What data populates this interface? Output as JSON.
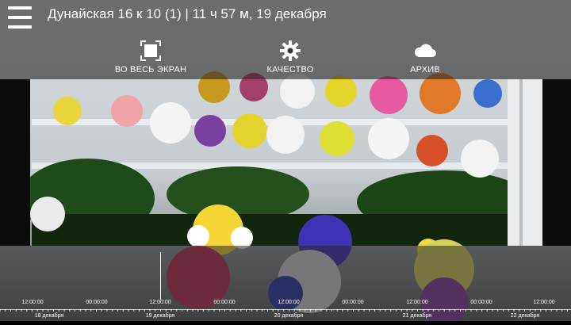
{
  "header": {
    "title": "Дунайская 16 к 10 (1) | 11 ч 57 м, 19 декабря"
  },
  "toolbar": {
    "fullscreen_label": "ВО ВЕСЬ ЭКРАН",
    "quality_label": "КАЧЕСТВО",
    "archive_label": "АРХИВ"
  },
  "icons": {
    "menu": "hamburger-icon",
    "fullscreen": "fullscreen-icon",
    "quality": "gear-icon",
    "archive": "cloud-icon"
  },
  "timeline": {
    "time_labels": [
      "12:00:00",
      "00:00:00",
      "12:00:00",
      "00:00:00",
      "12:00:00",
      "00:00:00",
      "12:00:00",
      "00:00:00",
      "12:00:00"
    ],
    "day_labels": [
      "18 декабря",
      "19 декабря",
      "20 декабря",
      "21 декабря",
      "22 декабря"
    ]
  },
  "colors": {
    "overlay": "#282828",
    "text": "#ffffff"
  }
}
